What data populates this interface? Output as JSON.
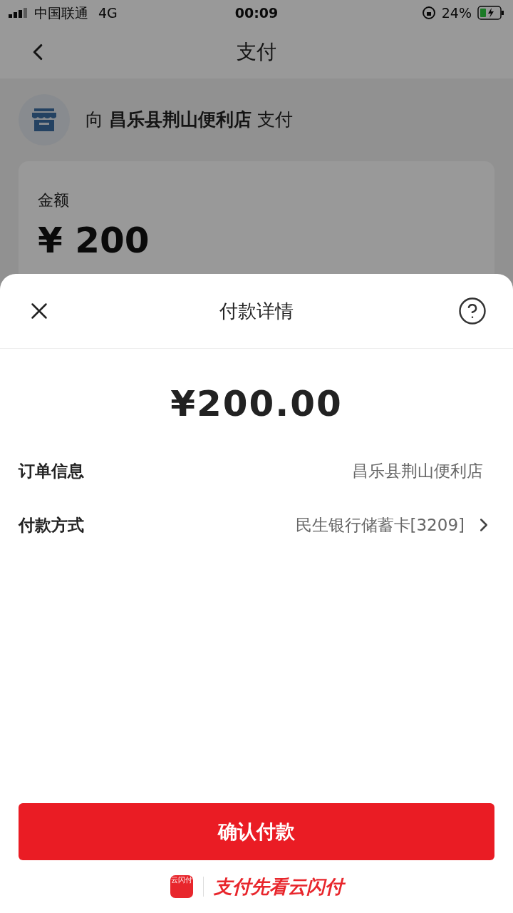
{
  "status_bar": {
    "carrier": "中国联通",
    "network": "4G",
    "time": "00:09",
    "battery": "24%"
  },
  "nav": {
    "title": "支付"
  },
  "merchant": {
    "prefix": "向",
    "name": "昌乐县荆山便利店",
    "suffix": "支付"
  },
  "amount_card": {
    "label": "金额",
    "value": "¥ 200"
  },
  "sheet": {
    "title": "付款详情",
    "amount": "¥200.00",
    "rows": [
      {
        "label": "订单信息",
        "value": "昌乐县荆山便利店",
        "chevron": false
      },
      {
        "label": "付款方式",
        "value": "民生银行储蓄卡[3209]",
        "chevron": true
      }
    ],
    "confirm": "确认付款",
    "footer": {
      "app_name": "云闪付",
      "slogan": "支付先看云闪付"
    }
  }
}
